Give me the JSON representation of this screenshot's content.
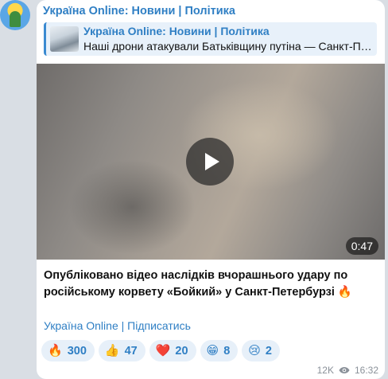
{
  "channel": {
    "name": "Україна Online: Новини | Політика"
  },
  "reply": {
    "title": "Україна Online: Новини | Політика",
    "text": "Наші дрони атакували Батьківщину путіна — Санкт-Петербург!"
  },
  "video": {
    "duration": "0:47",
    "play_icon": "play-icon"
  },
  "post": {
    "text": "Опубліковано відео наслідків вчорашнього удару по російському корвету «Бойкий» у Санкт-Петербурзі 🔥",
    "subscribe_link": "Україна Online | Підписатись"
  },
  "reactions": [
    {
      "emoji": "🔥",
      "count": "300"
    },
    {
      "emoji": "👍",
      "count": "47"
    },
    {
      "emoji": "❤️",
      "count": "20"
    },
    {
      "emoji": "😁",
      "count": "8"
    },
    {
      "emoji": "😢",
      "count": "2"
    }
  ],
  "meta": {
    "views": "12K",
    "time": "16:32",
    "views_icon": "eye-icon"
  },
  "colors": {
    "accent": "#2f7fc4",
    "background": "#d9dee4",
    "bubble": "#ffffff"
  }
}
